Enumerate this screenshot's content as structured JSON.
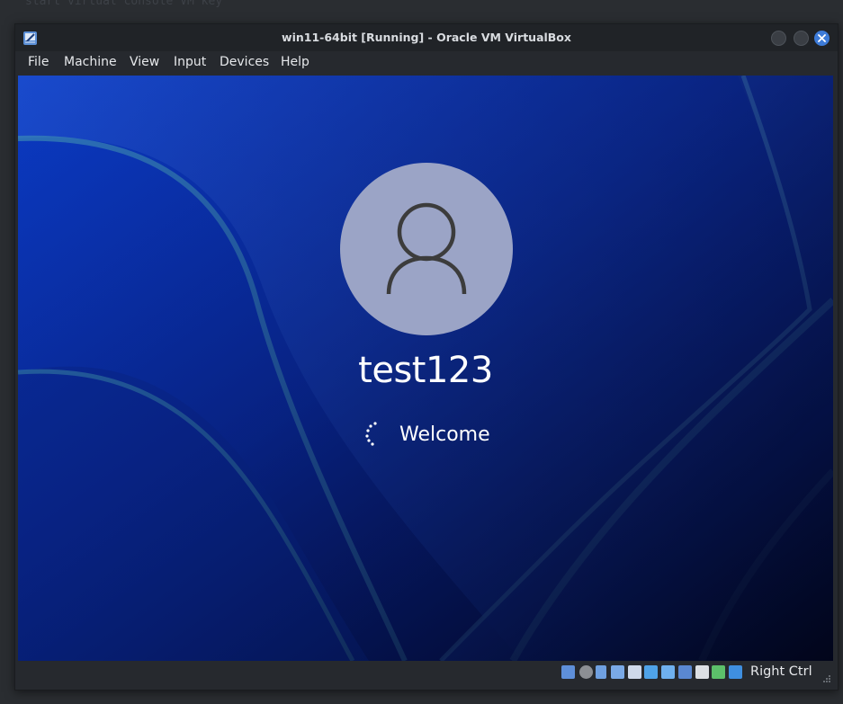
{
  "background": {
    "ghost_text": "start virtual console VM key"
  },
  "window": {
    "title": "win11-64bit [Running] - Oracle VM VirtualBox",
    "app_icon": "virtualbox-icon",
    "close_color": "#3d7bd8"
  },
  "menubar": {
    "items": [
      "File",
      "Machine",
      "View",
      "Input",
      "Devices",
      "Help"
    ]
  },
  "login": {
    "username": "test123",
    "status": "Welcome",
    "avatar_icon": "user-icon",
    "avatar_color": "#9ba4c6",
    "wallpaper_color": "#0a2a9a"
  },
  "statusbar": {
    "icons": [
      "hard-disk-icon",
      "optical-drive-icon",
      "audio-icon",
      "network-icon",
      "usb-icon",
      "shared-folders-icon",
      "display-icon",
      "recording-icon",
      "virtualization-icon",
      "cpu-icon",
      "keyboard-capture-icon"
    ],
    "host_key": "Right Ctrl"
  }
}
